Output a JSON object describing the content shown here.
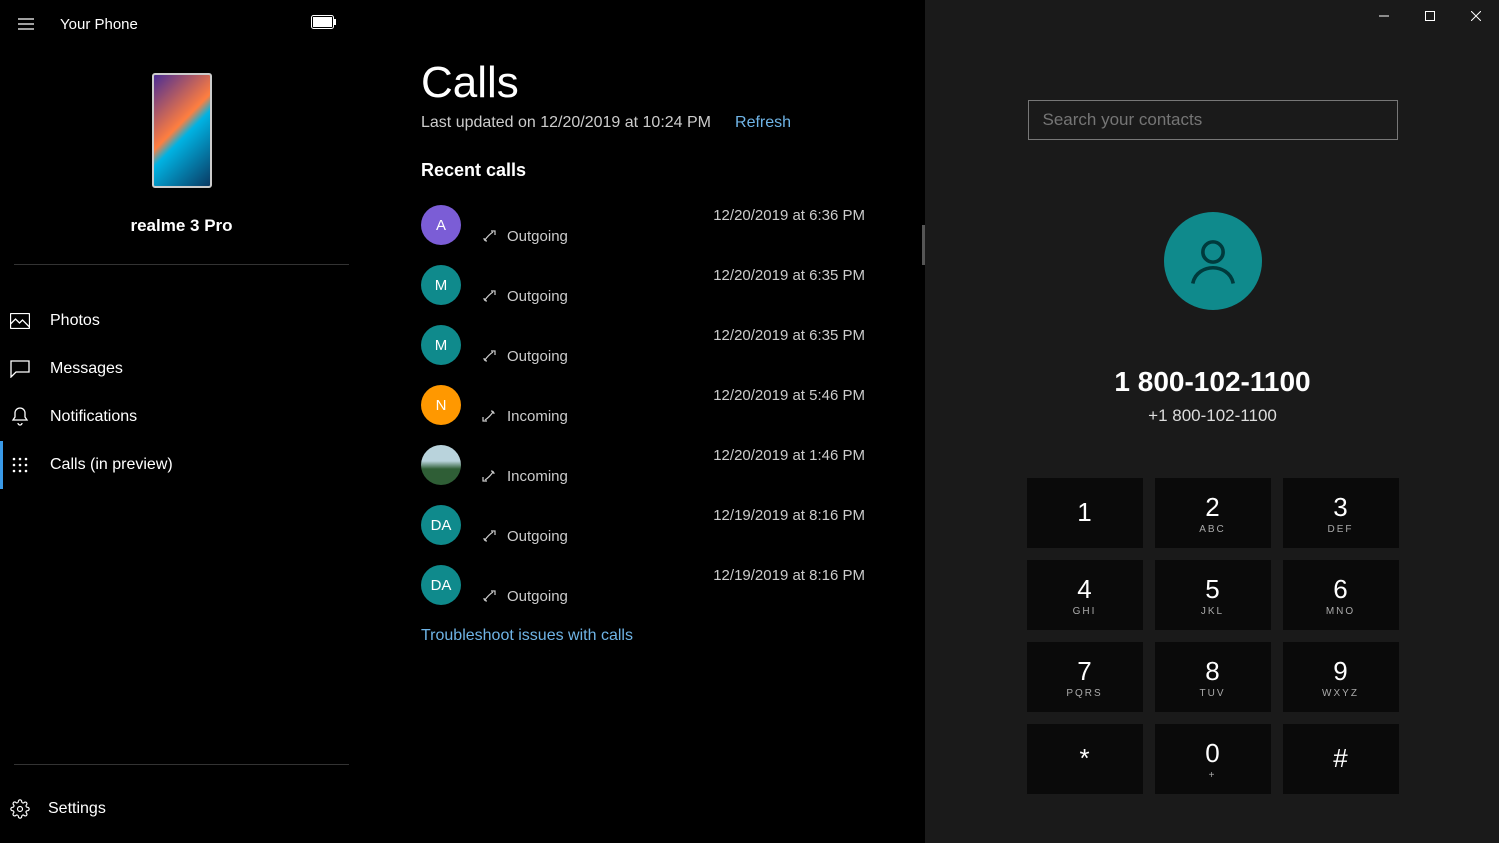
{
  "app_title": "Your Phone",
  "phone_name": "realme 3 Pro",
  "nav": [
    {
      "label": "Photos",
      "icon": "photos-icon"
    },
    {
      "label": "Messages",
      "icon": "messages-icon"
    },
    {
      "label": "Notifications",
      "icon": "notifications-icon"
    },
    {
      "label": "Calls (in preview)",
      "icon": "dialpad-icon",
      "active": true
    }
  ],
  "settings_label": "Settings",
  "page_title": "Calls",
  "last_updated": "Last updated on 12/20/2019 at 10:24 PM",
  "refresh_label": "Refresh",
  "recent_label": "Recent calls",
  "troubleshoot_label": "Troubleshoot issues with calls",
  "calls": [
    {
      "initials": "A",
      "color": "#7b5dd6",
      "direction": "Outgoing",
      "time": "12/20/2019 at 6:36 PM"
    },
    {
      "initials": "M",
      "color": "#0f8a8c",
      "direction": "Outgoing",
      "time": "12/20/2019 at 6:35 PM"
    },
    {
      "initials": "M",
      "color": "#0f8a8c",
      "direction": "Outgoing",
      "time": "12/20/2019 at 6:35 PM"
    },
    {
      "initials": "N",
      "color": "#ff9800",
      "direction": "Incoming",
      "time": "12/20/2019 at 5:46 PM"
    },
    {
      "initials": "",
      "color": "photo",
      "direction": "Incoming",
      "time": "12/20/2019 at 1:46 PM"
    },
    {
      "initials": "DA",
      "color": "#0f8a8c",
      "direction": "Outgoing",
      "time": "12/19/2019 at 8:16 PM"
    },
    {
      "initials": "DA",
      "color": "#0f8a8c",
      "direction": "Outgoing",
      "time": "12/19/2019 at 8:16 PM"
    }
  ],
  "search_placeholder": "Search your contacts",
  "contact": {
    "display_name": "1 800-102-1100",
    "number": "+1 800-102-1100"
  },
  "dialpad": [
    {
      "d": "1",
      "s": ""
    },
    {
      "d": "2",
      "s": "ABC"
    },
    {
      "d": "3",
      "s": "DEF"
    },
    {
      "d": "4",
      "s": "GHI"
    },
    {
      "d": "5",
      "s": "JKL"
    },
    {
      "d": "6",
      "s": "MNO"
    },
    {
      "d": "7",
      "s": "PQRS"
    },
    {
      "d": "8",
      "s": "TUV"
    },
    {
      "d": "9",
      "s": "WXYZ"
    },
    {
      "d": "*",
      "s": ""
    },
    {
      "d": "0",
      "s": "+"
    },
    {
      "d": "#",
      "s": ""
    }
  ]
}
